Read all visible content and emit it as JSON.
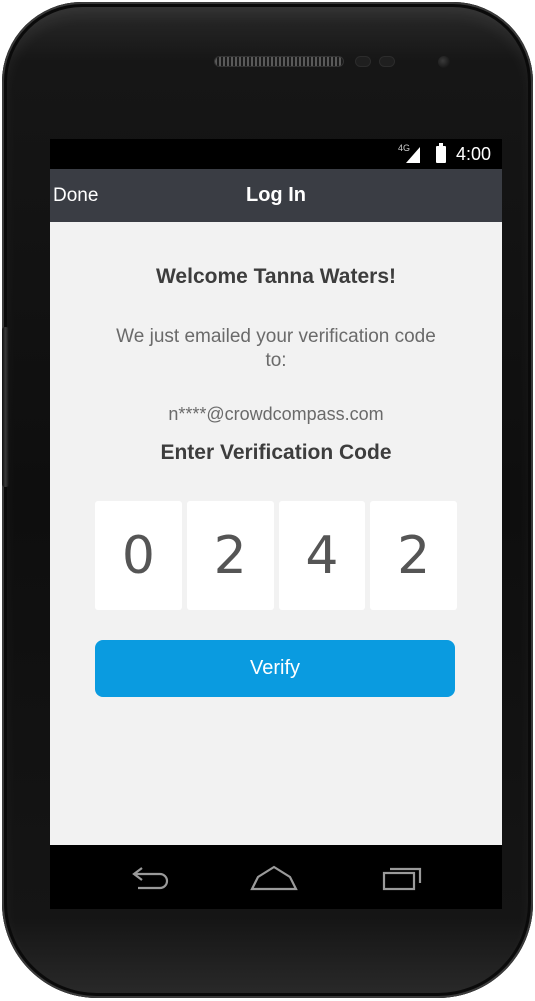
{
  "status_bar": {
    "network": "4G",
    "time": "4:00"
  },
  "app_bar": {
    "done_label": "Done",
    "title": "Log In"
  },
  "content": {
    "welcome": "Welcome Tanna Waters!",
    "emailed_message": "We just emailed your verification code to:",
    "email": "n****@crowdcompass.com",
    "enter_code_label": "Enter Verification Code",
    "code_digits": [
      "0",
      "2",
      "4",
      "2"
    ],
    "verify_label": "Verify"
  },
  "nav_bar": {
    "icons": [
      "back-icon",
      "home-icon",
      "recent-apps-icon"
    ]
  },
  "colors": {
    "app_bar": "#3a3d44",
    "content_bg": "#f2f2f2",
    "verify_button": "#0a9be0"
  }
}
